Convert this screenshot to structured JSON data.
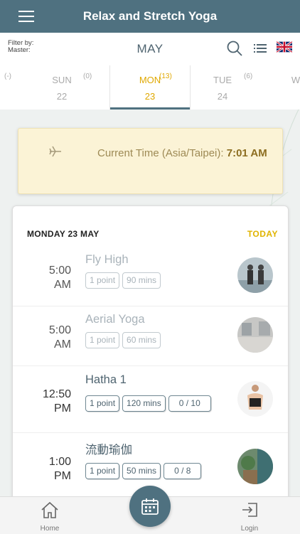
{
  "header": {
    "title": "Relax and Stretch Yoga"
  },
  "filter": {
    "label_line1": "Filter by:",
    "label_line2": "Master:",
    "month": "MAY"
  },
  "days": [
    {
      "name": "",
      "num": "",
      "count": "(-)"
    },
    {
      "name": "SUN",
      "num": "22",
      "count": "(0)"
    },
    {
      "name": "MON",
      "num": "23",
      "count": "(13)",
      "active": true
    },
    {
      "name": "TUE",
      "num": "24",
      "count": "(6)"
    },
    {
      "name": "W",
      "num": "",
      "count": ""
    }
  ],
  "current_time": {
    "label": "Current Time (Asia/Taipei): ",
    "value": "7:01 AM"
  },
  "schedule": {
    "date": "MONDAY 23 MAY",
    "today_label": "TODAY",
    "classes": [
      {
        "time_line1": "5:00",
        "time_line2": "AM",
        "name": "Fly High",
        "points": "1 point",
        "duration": "90 mins",
        "capacity": ""
      },
      {
        "time_line1": "5:00",
        "time_line2": "AM",
        "name": "Aerial Yoga",
        "points": "1 point",
        "duration": "60 mins",
        "capacity": ""
      },
      {
        "time_line1": "12:50",
        "time_line2": "PM",
        "name": "Hatha 1",
        "points": "1 point",
        "duration": "120 mins",
        "capacity": "0 / 10"
      },
      {
        "time_line1": "1:00",
        "time_line2": "PM",
        "name": "流動瑜伽",
        "points": "1 point",
        "duration": "50 mins",
        "capacity": "0 / 8"
      }
    ]
  },
  "nav": {
    "home_label": "Home",
    "login_label": "Login"
  },
  "colors": {
    "primary": "#4f7180",
    "accent": "#e0a800",
    "notice_bg": "#fbf3d6"
  },
  "icons": {
    "menu": "hamburger-icon",
    "search": "search-icon",
    "list": "list-icon",
    "language": "uk-flag-icon",
    "notice": "airplane-icon",
    "home": "home-icon",
    "calendar": "calendar-icon",
    "login": "login-icon"
  }
}
